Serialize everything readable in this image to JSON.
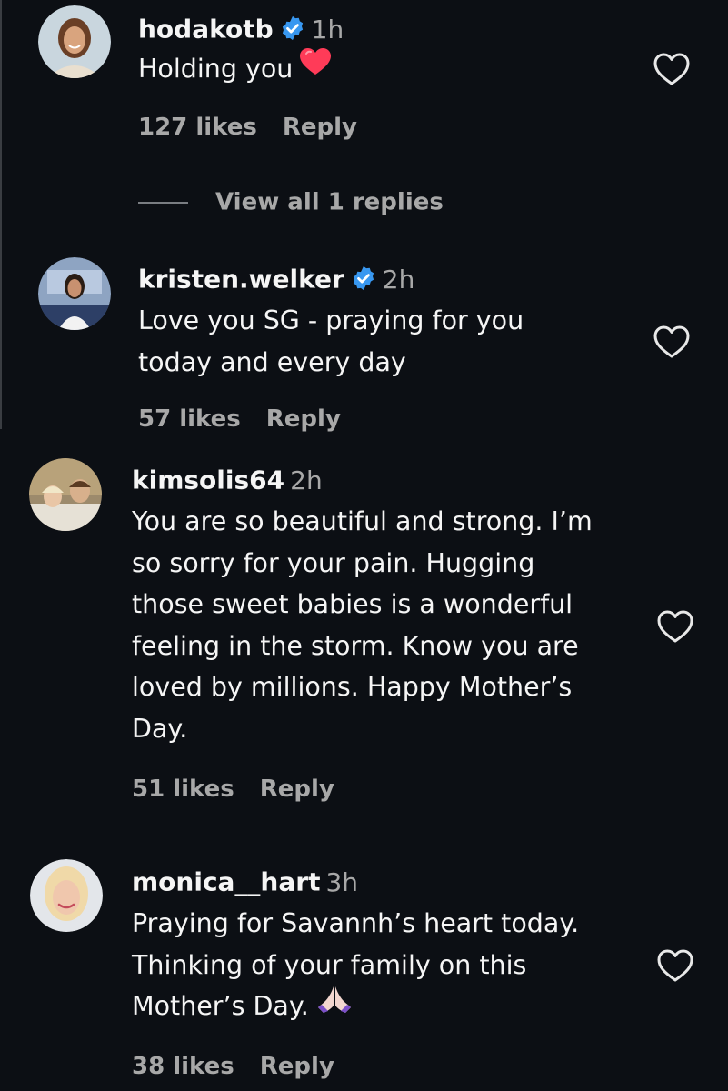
{
  "comments": [
    {
      "username": "hodakotb",
      "verified": true,
      "time": "1h",
      "lines": [
        "Holding you"
      ],
      "emoji": "red-heart",
      "likes": "127 likes",
      "reply": "Reply",
      "view_replies": "View all 1 replies",
      "avatar_icon": "avatar-photo"
    },
    {
      "username": "kristen.welker",
      "verified": true,
      "time": "2h",
      "lines": [
        "Love you SG - praying for you",
        "today and every day"
      ],
      "likes": "57 likes",
      "reply": "Reply",
      "avatar_icon": "avatar-photo"
    },
    {
      "username": "kimsolis64",
      "verified": false,
      "time": "2h",
      "lines": [
        "You are so beautiful and strong. I’m",
        "so sorry for your pain. Hugging",
        "those sweet babies is a wonderful",
        "feeling in the storm. Know you are",
        "loved by millions. Happy Mother’s",
        "Day."
      ],
      "likes": "51 likes",
      "reply": "Reply",
      "avatar_icon": "avatar-photo"
    },
    {
      "username": "monica__hart",
      "verified": false,
      "time": "3h",
      "lines": [
        "Praying for Savannh’s heart today.",
        "Thinking of your family on this",
        "Mother’s Day."
      ],
      "emoji": "praying-hands",
      "likes": "38 likes",
      "reply": "Reply",
      "avatar_icon": "avatar-photo"
    }
  ],
  "colors": {
    "background": "#0c0f14",
    "text_primary": "#f5f5f5",
    "text_secondary": "#a8a8a8",
    "verified_blue": "#3897f0",
    "heart_red": "#ff3040"
  }
}
